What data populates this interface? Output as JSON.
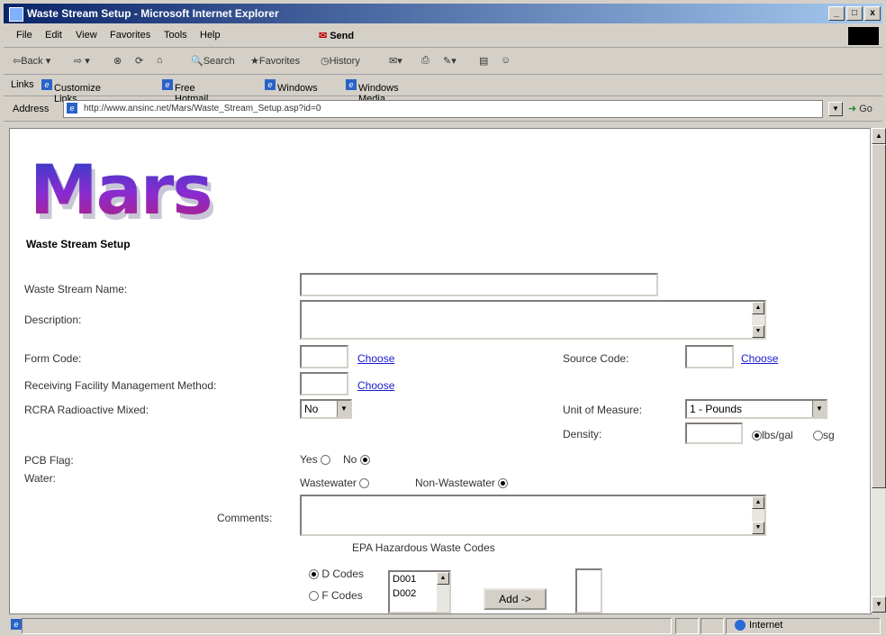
{
  "window": {
    "title": "Waste Stream Setup - Microsoft Internet Explorer"
  },
  "menu": [
    "File",
    "Edit",
    "View",
    "Favorites",
    "Tools",
    "Help"
  ],
  "send_label": "Send",
  "toolbar": {
    "back": "Back",
    "search": "Search",
    "favorites": "Favorites",
    "history": "History"
  },
  "links": {
    "label": "Links",
    "items": [
      "Customize Links",
      "Free Hotmail",
      "Windows",
      "Windows Media"
    ]
  },
  "address": {
    "label": "Address",
    "url": "http://www.ansinc.net/Mars/Waste_Stream_Setup.asp?id=0",
    "go": "Go"
  },
  "page": {
    "logo": "Mars",
    "subtitle": "Waste Stream Setup",
    "labels": {
      "name": "Waste Stream Name:",
      "description": "Description:",
      "form_code": "Form Code:",
      "source_code": "Source Code:",
      "receiving": "Receiving Facility Management Method:",
      "rcra": "RCRA Radioactive Mixed:",
      "unit": "Unit of Measure:",
      "density": "Density:",
      "pcb": "PCB Flag:",
      "water": "Water:",
      "comments": "Comments:",
      "epa": "EPA Hazardous Waste Codes"
    },
    "choose": "Choose",
    "rcra_value": "No",
    "unit_value": "1 - Pounds",
    "density_options": {
      "lbs": "lbs/gal",
      "sg": "sg"
    },
    "pcb_options": {
      "yes": "Yes",
      "no": "No"
    },
    "water_options": {
      "ww": "Wastewater",
      "nww": "Non-Wastewater"
    },
    "code_types": {
      "d": "D Codes",
      "f": "F Codes"
    },
    "code_list": [
      "D001",
      "D002"
    ],
    "add_button": "Add ->"
  },
  "status": {
    "zone": "Internet"
  }
}
